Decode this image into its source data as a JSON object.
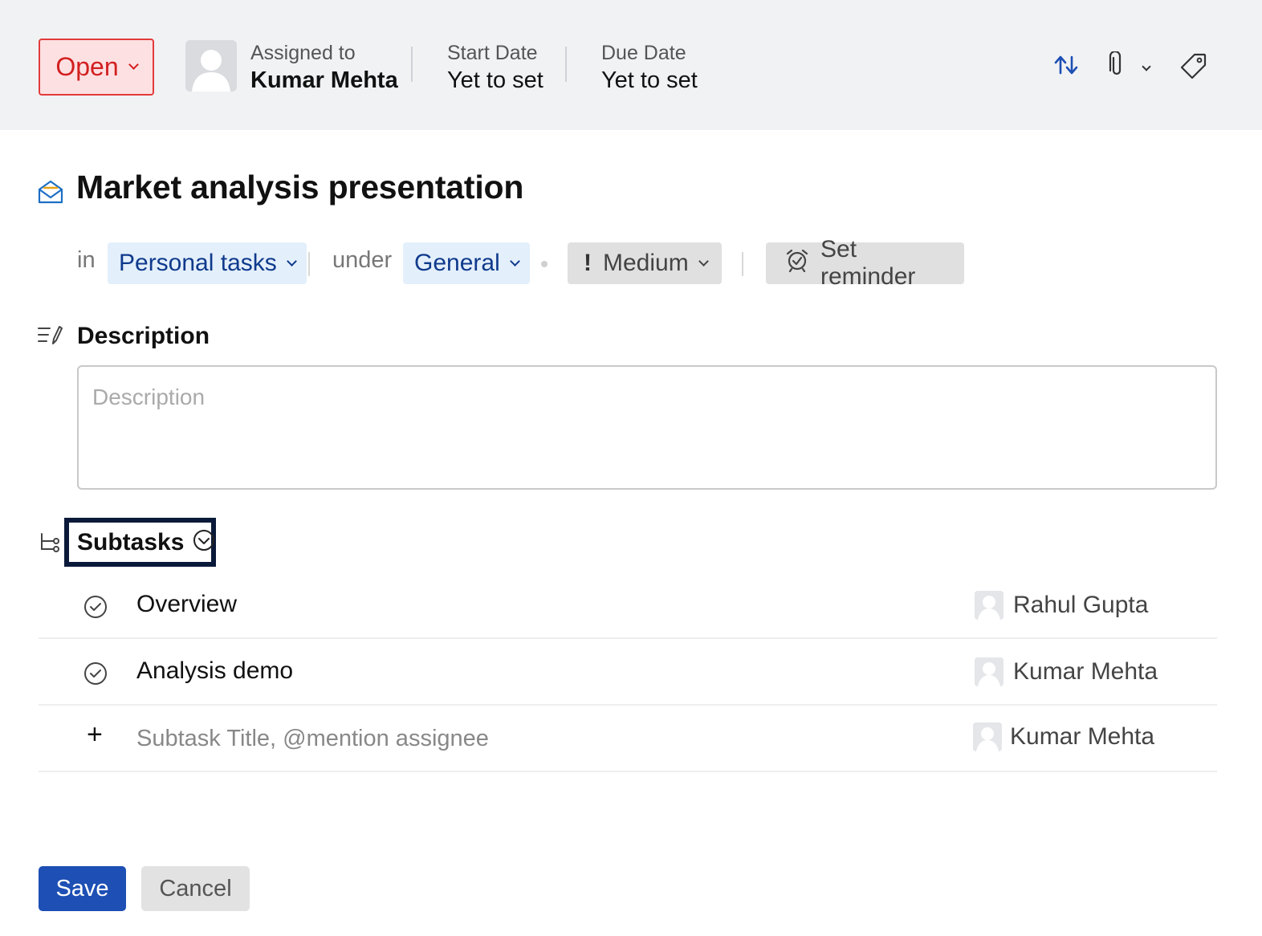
{
  "header": {
    "status": {
      "label": "Open",
      "color": "#d21f1f"
    },
    "assigned": {
      "label": "Assigned to",
      "value": "Kumar Mehta"
    },
    "start_date": {
      "label": "Start Date",
      "value": "Yet to set"
    },
    "due_date": {
      "label": "Due Date",
      "value": "Yet to set"
    },
    "icons": [
      "reorder-arrows-icon",
      "paperclip-icon",
      "chevron-down-icon",
      "tag-icon"
    ]
  },
  "task": {
    "title": "Market analysis presentation",
    "in_label": "in",
    "list": "Personal tasks",
    "under_label": "under",
    "section": "General",
    "priority": "Medium",
    "reminder": "Set reminder"
  },
  "description": {
    "heading": "Description",
    "placeholder": "Description"
  },
  "subtasks": {
    "heading": "Subtasks",
    "items": [
      {
        "name": "Overview",
        "assignee": "Rahul Gupta"
      },
      {
        "name": "Analysis demo",
        "assignee": "Kumar Mehta"
      }
    ],
    "new_placeholder": "Subtask Title, @mention assignee",
    "new_assignee": "Kumar Mehta"
  },
  "footer": {
    "save": "Save",
    "cancel": "Cancel"
  },
  "colors": {
    "accent": "#1d4fb4",
    "status_bg": "#fde0e2",
    "chip_blue_bg": "#e3effb",
    "chip_blue_text": "#0f3a8c"
  }
}
